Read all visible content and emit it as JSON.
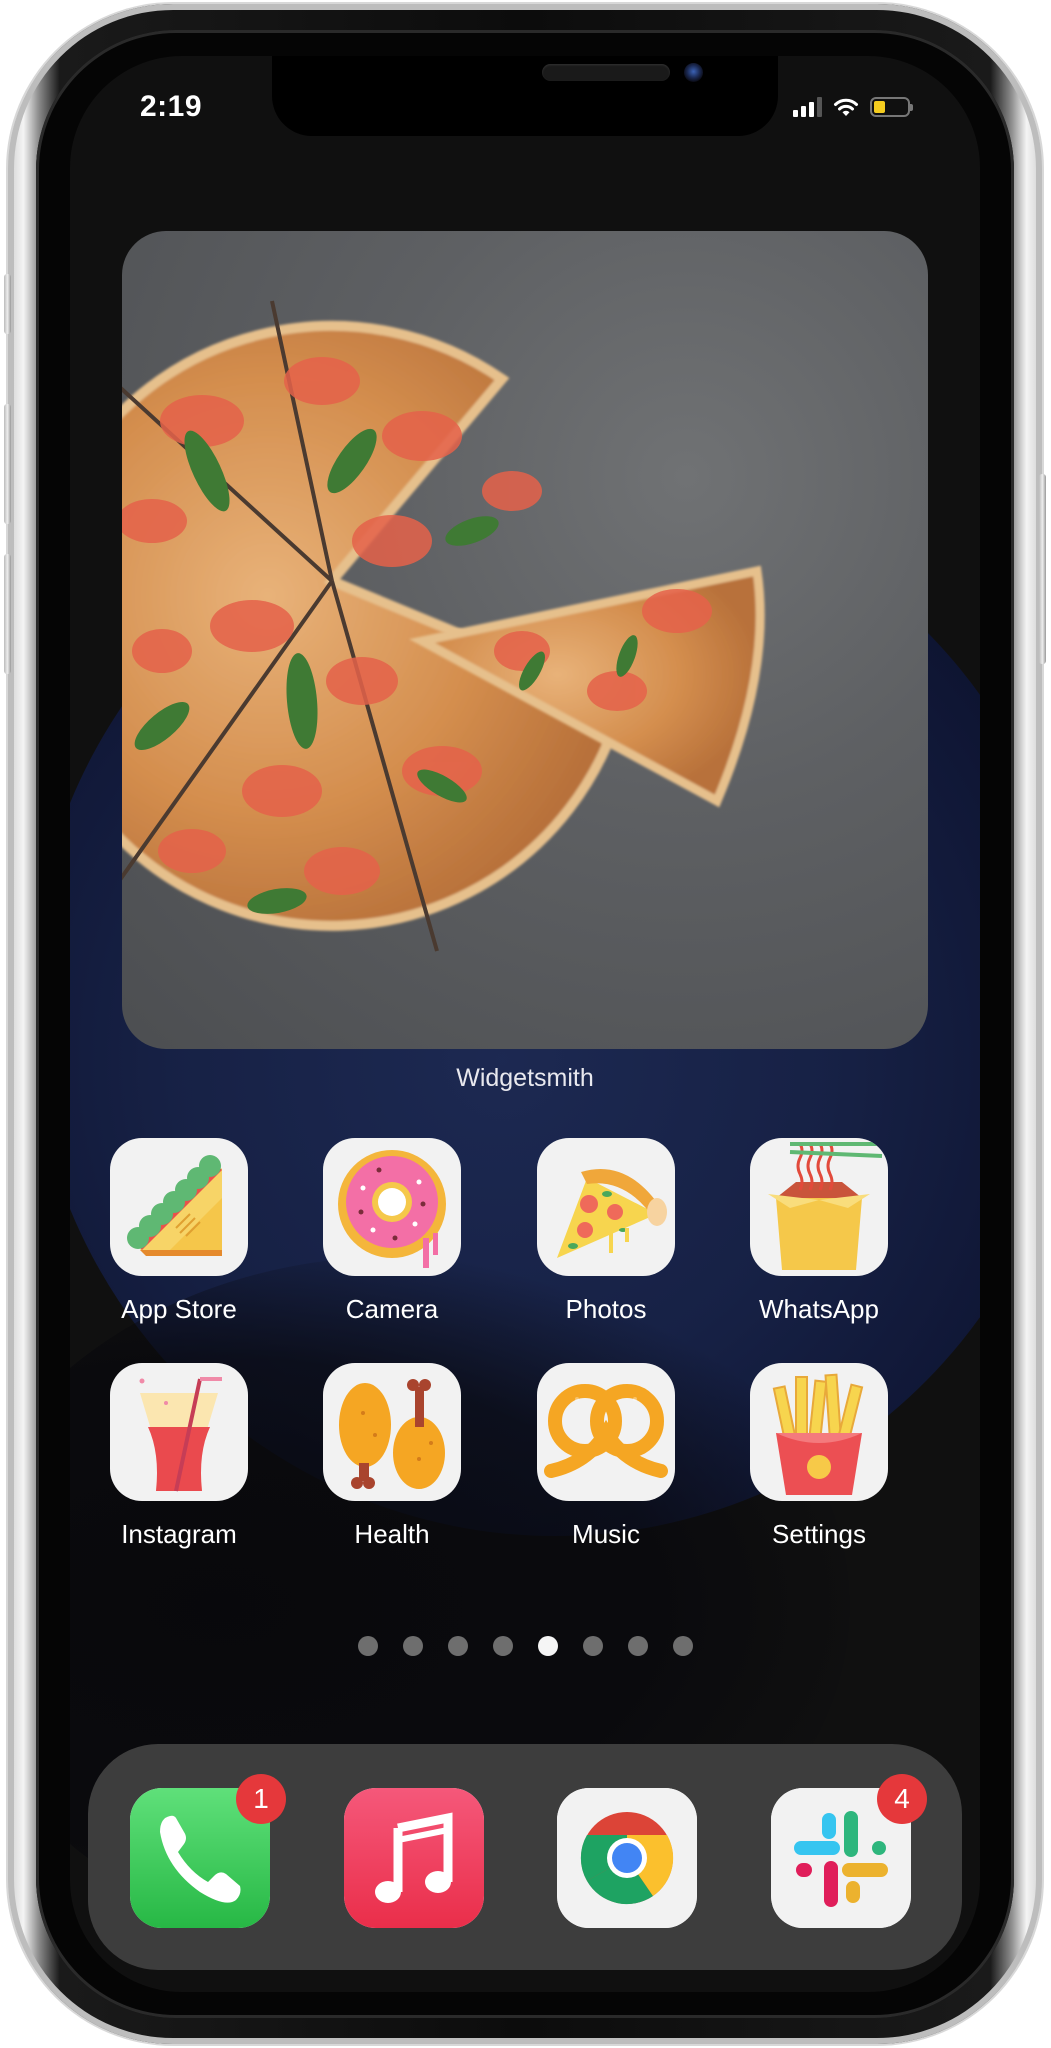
{
  "status_bar": {
    "time": "2:19",
    "signal_bars_active": 3,
    "signal_bars_total": 4,
    "wifi": "wifi-icon",
    "battery_level": 0.35,
    "battery_color": "#f5cd1f",
    "low_power_mode": true
  },
  "widget": {
    "app_name": "Widgetsmith",
    "content": "pizza-photo"
  },
  "home_apps": [
    {
      "label": "App Store",
      "icon": "sandwich-icon"
    },
    {
      "label": "Camera",
      "icon": "donut-icon"
    },
    {
      "label": "Photos",
      "icon": "pizza-slice-icon"
    },
    {
      "label": "WhatsApp",
      "icon": "noodle-box-icon"
    },
    {
      "label": "Instagram",
      "icon": "soda-glass-icon"
    },
    {
      "label": "Health",
      "icon": "chicken-drumstick-icon"
    },
    {
      "label": "Music",
      "icon": "pretzel-icon"
    },
    {
      "label": "Settings",
      "icon": "french-fries-icon"
    }
  ],
  "page_indicator": {
    "total_pages": 8,
    "current_page": 5
  },
  "dock": [
    {
      "app": "Phone",
      "icon": "phone-icon",
      "badge": "1",
      "color": "#34c759"
    },
    {
      "app": "Music",
      "icon": "music-note-icon",
      "badge": null,
      "color": "#f0344f"
    },
    {
      "app": "Chrome",
      "icon": "chrome-icon",
      "badge": null,
      "color": "#f2f2f2"
    },
    {
      "app": "Slack",
      "icon": "slack-icon",
      "badge": "4",
      "color": "#f2f2f2"
    }
  ],
  "colors": {
    "badge": "#e5383b",
    "label_text": "#ffffff",
    "dock_bg": "#3d3d3d"
  }
}
